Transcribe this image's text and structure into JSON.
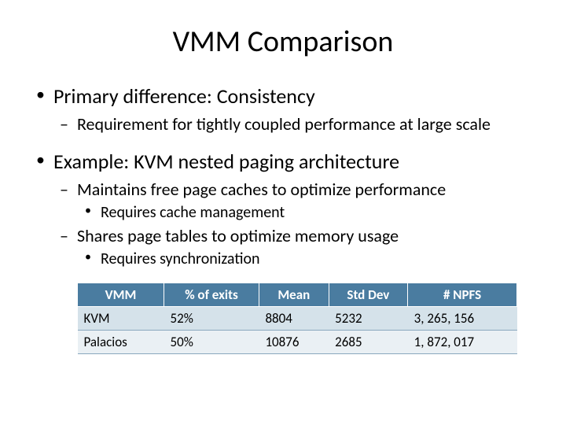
{
  "title": "VMM Comparison",
  "bullets": {
    "b1": "Primary difference: Consistency",
    "b1_1": "Requirement for tightly coupled performance at large scale",
    "b2": "Example: KVM nested paging architecture",
    "b2_1": "Maintains free page caches to optimize performance",
    "b2_1_1": "Requires cache management",
    "b2_2": "Shares page tables to optimize memory usage",
    "b2_2_1": "Requires synchronization"
  },
  "table": {
    "headers": {
      "h0": "VMM",
      "h1": "% of exits",
      "h2": "Mean",
      "h3": "Std Dev",
      "h4": "# NPFS"
    },
    "rows": [
      {
        "c0": "KVM",
        "c1": "52%",
        "c2": "8804",
        "c3": "5232",
        "c4": "3, 265, 156"
      },
      {
        "c0": "Palacios",
        "c1": "50%",
        "c2": "10876",
        "c3": "2685",
        "c4": "1, 872, 017"
      }
    ]
  },
  "chart_data": {
    "type": "table",
    "title": "VMM Comparison",
    "columns": [
      "VMM",
      "% of exits",
      "Mean",
      "Std Dev",
      "# NPFS"
    ],
    "rows": [
      [
        "KVM",
        "52%",
        8804,
        5232,
        3265156
      ],
      [
        "Palacios",
        "50%",
        10876,
        2685,
        1872017
      ]
    ]
  }
}
